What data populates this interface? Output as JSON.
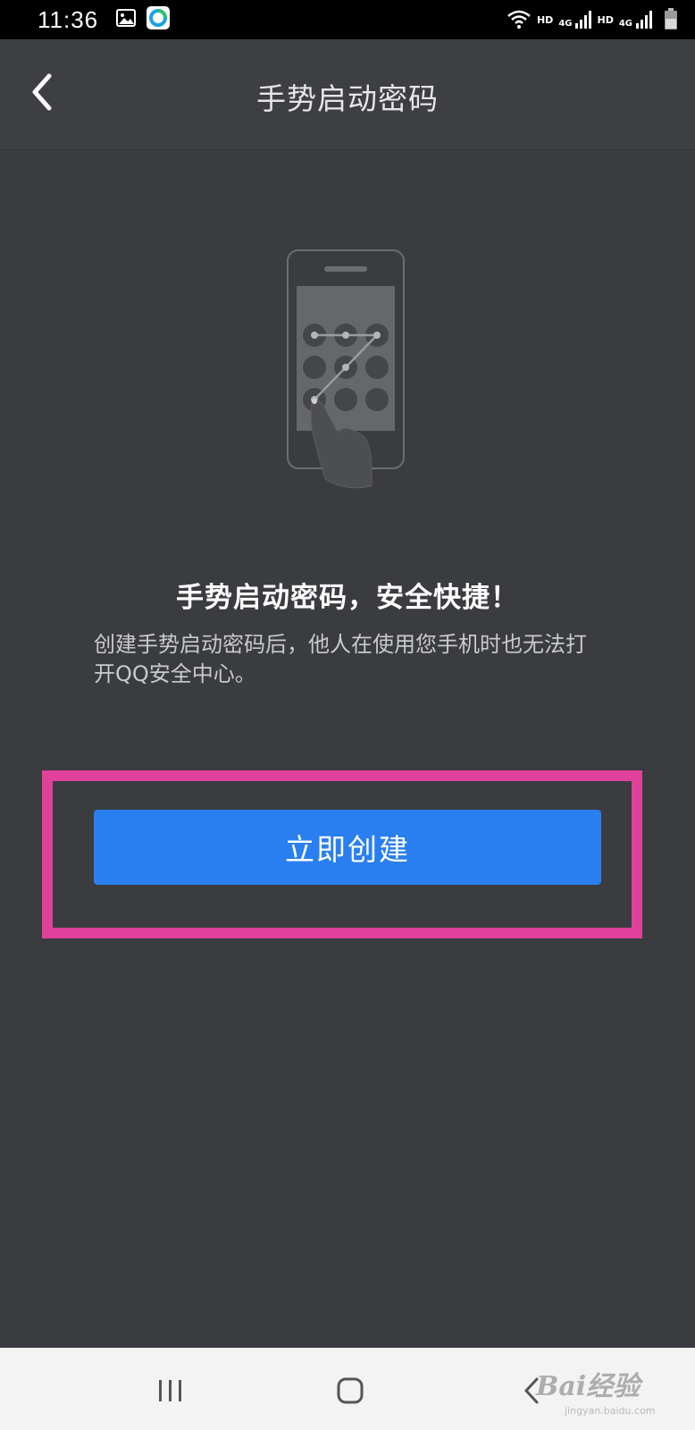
{
  "status_bar": {
    "time": "11:36",
    "indicators": [
      "HD",
      "4G",
      "HD",
      "4G"
    ],
    "icons": [
      "image-icon",
      "app-icon",
      "wifi-icon",
      "signal-icon",
      "signal-icon",
      "battery-icon"
    ]
  },
  "header": {
    "title": "手势启动密码",
    "back_icon": "chevron-left-icon"
  },
  "illustration": {
    "icon": "gesture-unlock-phone-icon"
  },
  "content": {
    "headline": "手势启动密码，安全快捷！",
    "description": "创建手势启动密码后，他人在使用您手机时也无法打开QQ安全中心。"
  },
  "actions": {
    "create_label": "立即创建"
  },
  "navbar": {
    "icons": [
      "recents-icon",
      "home-icon",
      "back-icon"
    ]
  },
  "watermark": {
    "brand": "Bai经验",
    "domain": "jingyan.baidu.com"
  },
  "colors": {
    "background": "#3b3c40",
    "header": "#3e3f43",
    "primary_button": "#2a7ff0",
    "highlight": "#e0419b"
  }
}
